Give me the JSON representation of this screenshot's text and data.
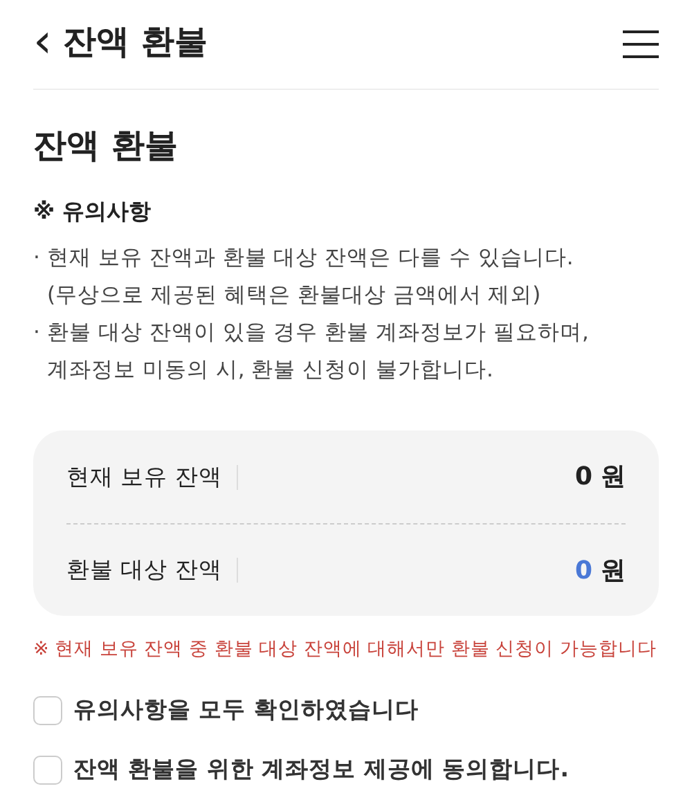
{
  "header": {
    "back_icon": "‹",
    "title": "잔액 환불"
  },
  "page_title": "잔액 환불",
  "notice": {
    "heading": "※ 유의사항",
    "items": [
      {
        "bullet": "·",
        "lines": [
          "현재 보유 잔액과 환불 대상 잔액은 다를 수 있습니다.",
          "(무상으로 제공된 혜택은 환불대상 금액에서 제외)"
        ]
      },
      {
        "bullet": "·",
        "lines": [
          "환불 대상 잔액이 있을 경우 환불 계좌정보가 필요하며,",
          "계좌정보 미동의 시, 환불 신청이 불가합니다."
        ]
      }
    ]
  },
  "balances": [
    {
      "label": "현재 보유 잔액",
      "amount": "0",
      "unit": "원",
      "highlighted": false
    },
    {
      "label": "환불 대상 잔액",
      "amount": "0",
      "unit": "원",
      "highlighted": true
    }
  ],
  "warning": "※ 현재 보유 잔액 중 환불 대상 잔액에 대해서만 환불 신청이 가능합니다",
  "agreements": [
    {
      "label": "유의사항을 모두 확인하였습니다",
      "checked": false
    },
    {
      "label": "잔액 환불을 위한 계좌정보 제공에 동의합니다.",
      "checked": false
    }
  ]
}
